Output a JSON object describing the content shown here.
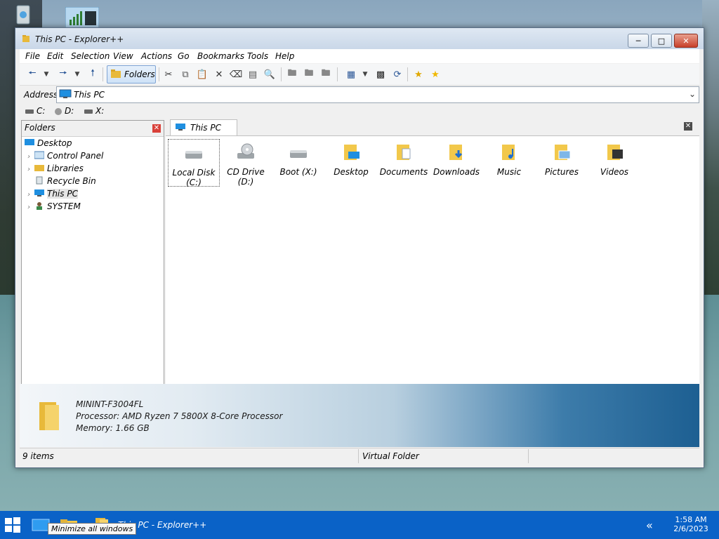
{
  "window": {
    "title": "This PC - Explorer++"
  },
  "menu": [
    "File",
    "Edit",
    "Selection",
    "View",
    "Actions",
    "Go",
    "Bookmarks",
    "Tools",
    "Help"
  ],
  "toolbar": {
    "folders_label": "Folders"
  },
  "address": {
    "label": "Address",
    "value": "This PC"
  },
  "drives": [
    "C:",
    "D:",
    "X:"
  ],
  "folders_pane": {
    "title": "Folders",
    "tree": [
      {
        "label": "Desktop",
        "level": 0,
        "expandable": false,
        "icon": "desktop-icon"
      },
      {
        "label": "Control Panel",
        "level": 1,
        "expandable": true,
        "icon": "control-panel-icon"
      },
      {
        "label": "Libraries",
        "level": 1,
        "expandable": true,
        "icon": "libraries-icon"
      },
      {
        "label": "Recycle Bin",
        "level": 1,
        "expandable": false,
        "icon": "recycle-bin-icon"
      },
      {
        "label": "This PC",
        "level": 1,
        "expandable": true,
        "icon": "this-pc-icon",
        "selected": true
      },
      {
        "label": "SYSTEM",
        "level": 1,
        "expandable": true,
        "icon": "user-icon"
      }
    ]
  },
  "tab": {
    "label": "This PC"
  },
  "items": [
    {
      "label": "Local Disk (C:)",
      "icon": "hard-disk-icon"
    },
    {
      "label": "CD Drive (D:)",
      "icon": "cd-drive-icon"
    },
    {
      "label": "Boot (X:)",
      "icon": "hard-disk-icon"
    },
    {
      "label": "Desktop",
      "icon": "desktop-folder-icon"
    },
    {
      "label": "Documents",
      "icon": "documents-folder-icon"
    },
    {
      "label": "Downloads",
      "icon": "downloads-folder-icon"
    },
    {
      "label": "Music",
      "icon": "music-folder-icon"
    },
    {
      "label": "Pictures",
      "icon": "pictures-folder-icon"
    },
    {
      "label": "Videos",
      "icon": "videos-folder-icon"
    }
  ],
  "info": {
    "computer_name": "MININT-F3004FL",
    "processor": "Processor: AMD Ryzen 7 5800X 8-Core Processor",
    "memory": "Memory: 1.66 GB"
  },
  "status": {
    "items": "9 items",
    "type": "Virtual Folder"
  },
  "taskbar": {
    "app_title": "This PC - Explorer++",
    "tooltip": "Minimize all windows",
    "time": "1:58 AM",
    "date": "2/6/2023"
  },
  "colors": {
    "taskbar": "#0a62c7",
    "selection": "#e5e5e5",
    "accent": "#2b5797"
  }
}
